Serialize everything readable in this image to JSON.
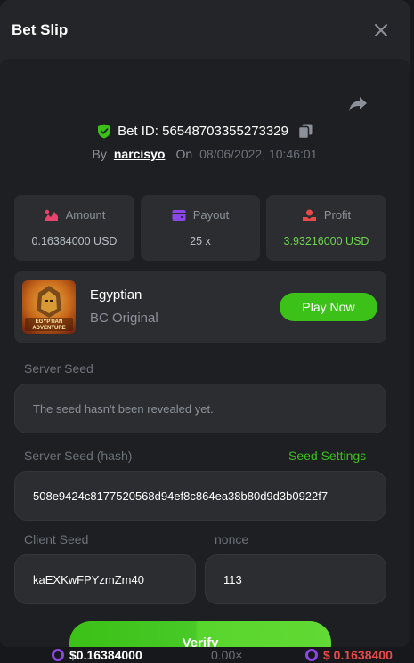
{
  "modal": {
    "title": "Bet Slip"
  },
  "bet": {
    "id_text": "Bet ID: 56548703355273329",
    "by_label": "By",
    "user": "narcisyo",
    "on_label": "On",
    "date": "08/06/2022, 10:46:01"
  },
  "stats": [
    {
      "label": "Amount",
      "value": "0.16384000 USD",
      "icon": "amount-icon"
    },
    {
      "label": "Payout",
      "value": "25 x",
      "icon": "payout-icon"
    },
    {
      "label": "Profit",
      "value": "3.93216000 USD",
      "icon": "profit-icon"
    }
  ],
  "game": {
    "name": "Egyptian",
    "subtitle": "BC Original",
    "thumb_text": "EGYPTIAN ADVENTURE",
    "play_label": "Play Now"
  },
  "server_seed": {
    "label": "Server Seed",
    "value": "The seed hasn't been revealed yet."
  },
  "server_hash": {
    "label": "Server Seed (hash)",
    "settings_label": "Seed Settings",
    "value": "508e9424c8177520568d94ef8c864ea38b80d9d3b0922f7"
  },
  "client_seed": {
    "label": "Client Seed",
    "value": "kaEXKwFPYzmZm40"
  },
  "nonce": {
    "label": "nonce",
    "value": "113"
  },
  "verify_label": "Verify",
  "bottom_bar": {
    "balance": "$0.16384000",
    "multiplier": "0.00×",
    "balance2": "$ 0.1638400"
  },
  "colors": {
    "accent_green": "#3bc117",
    "profit_green": "#6fd34b",
    "amount_icon": "#e8436b",
    "payout_icon": "#8b47e6",
    "profit_icon": "#e84a4a"
  }
}
